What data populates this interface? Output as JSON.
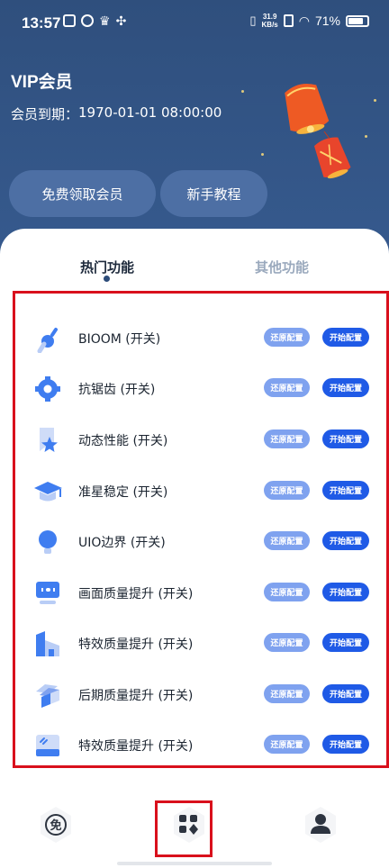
{
  "status_bar": {
    "time": "13:57",
    "network_speed_value": "31.9",
    "network_speed_unit": "KB/s",
    "battery": "71%"
  },
  "header": {
    "title": "VIP会员",
    "expire_label": "会员到期：",
    "expire_value": "1970-01-01 08:00:00",
    "buttons": {
      "free_vip": "免费领取会员",
      "tutorial": "新手教程"
    }
  },
  "tabs": {
    "hot": "热门功能",
    "other": "其他功能"
  },
  "features": [
    {
      "label": "BIOOM (开关)",
      "icon": "dropper-icon",
      "restore": "还原配置",
      "start": "开始配置"
    },
    {
      "label": "抗锯齿 (开关)",
      "icon": "gear-icon",
      "restore": "还原配置",
      "start": "开始配置"
    },
    {
      "label": "动态性能 (开关)",
      "icon": "star-badge-icon",
      "restore": "还原配置",
      "start": "开始配置"
    },
    {
      "label": "准星稳定 (开关)",
      "icon": "graduation-cap-icon",
      "restore": "还原配置",
      "start": "开始配置"
    },
    {
      "label": "UIO边界 (开关)",
      "icon": "bulb-icon",
      "restore": "还原配置",
      "start": "开始配置"
    },
    {
      "label": "画面质量提升 (开关)",
      "icon": "screen-icon",
      "restore": "还原配置",
      "start": "开始配置"
    },
    {
      "label": "特效质量提升 (开关)",
      "icon": "building-icon",
      "restore": "还原配置",
      "start": "开始配置"
    },
    {
      "label": "后期质量提升 (开关)",
      "icon": "layers-icon",
      "restore": "还原配置",
      "start": "开始配置"
    },
    {
      "label": "特效质量提升 (开关)",
      "icon": "card-icon",
      "restore": "还原配置",
      "start": "开始配置"
    }
  ],
  "bottom_nav": {
    "free_label": "免",
    "items": [
      "free-icon",
      "apps-icon",
      "profile-icon"
    ]
  },
  "colors": {
    "header_bg": "#2f4f7d",
    "accent_blue": "#1f5ae6",
    "light_blue": "#7fa2ef",
    "icon_blue": "#3f7df0",
    "highlight_red": "#d9101c"
  }
}
